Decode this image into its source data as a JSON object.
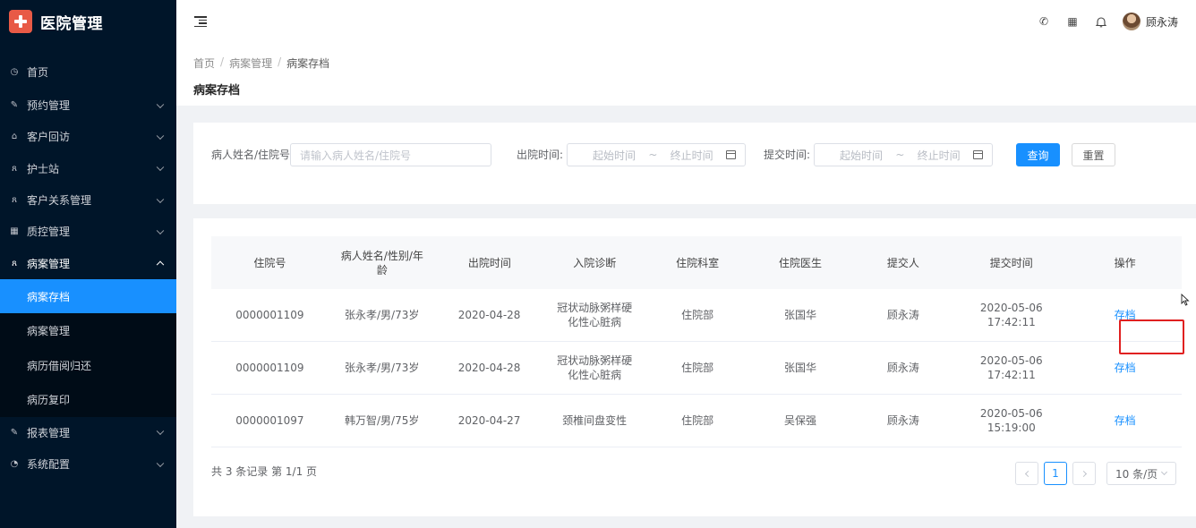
{
  "app": {
    "title": "医院管理"
  },
  "sidebar": {
    "items": [
      {
        "label": "首页",
        "icon": "dashboard-icon"
      },
      {
        "label": "预约管理",
        "icon": "edit-icon"
      },
      {
        "label": "客户回访",
        "icon": "home-icon"
      },
      {
        "label": "护士站",
        "icon": "nurse-icon"
      },
      {
        "label": "客户关系管理",
        "icon": "users-icon"
      },
      {
        "label": "质控管理",
        "icon": "table-icon"
      },
      {
        "label": "病案管理",
        "icon": "records-icon",
        "children": [
          "病案存档",
          "病案管理",
          "病历借阅归还",
          "病历复印"
        ],
        "active_child": "病案存档"
      },
      {
        "label": "报表管理",
        "icon": "report-icon"
      },
      {
        "label": "系统配置",
        "icon": "settings-icon"
      }
    ]
  },
  "header": {
    "username": "顾永涛",
    "icons": [
      "phone-icon",
      "grid-icon",
      "bell-icon"
    ]
  },
  "breadcrumb": [
    "首页",
    "病案管理",
    "病案存档"
  ],
  "page_title": "病案存档",
  "search": {
    "name_label": "病人姓名/住院号:",
    "name_placeholder": "请输入病人姓名/住院号",
    "discharge_label": "出院时间:",
    "submit_label": "提交时间:",
    "start_placeholder": "起始时间",
    "end_placeholder": "终止时间",
    "range_sep": "~",
    "query_button": "查询",
    "reset_button": "重置"
  },
  "table": {
    "headers": [
      "住院号",
      "病人姓名/性别/年龄",
      "出院时间",
      "入院诊断",
      "住院科室",
      "住院医生",
      "提交人",
      "提交时间",
      "操作"
    ],
    "rows": [
      {
        "id": "0000001109",
        "patient": "张永孝/男/73岁",
        "discharge": "2020-04-28",
        "diagnosis": "冠状动脉粥样硬化性心脏病",
        "dept": "住院部",
        "doctor": "张国华",
        "submitter": "顾永涛",
        "submit_date": "2020-05-06",
        "submit_time": "17:42:11",
        "action": "存档"
      },
      {
        "id": "0000001109",
        "patient": "张永孝/男/73岁",
        "discharge": "2020-04-28",
        "diagnosis": "冠状动脉粥样硬化性心脏病",
        "dept": "住院部",
        "doctor": "张国华",
        "submitter": "顾永涛",
        "submit_date": "2020-05-06",
        "submit_time": "17:42:11",
        "action": "存档"
      },
      {
        "id": "0000001097",
        "patient": "韩万智/男/75岁",
        "discharge": "2020-04-27",
        "diagnosis": "颈椎间盘变性",
        "dept": "住院部",
        "doctor": "吴保强",
        "submitter": "顾永涛",
        "submit_date": "2020-05-06",
        "submit_time": "15:19:00",
        "action": "存档"
      }
    ]
  },
  "pagination": {
    "total_text": "共 3 条记录 第 1/1 页",
    "current_page": "1",
    "page_size": "10 条/页"
  },
  "colors": {
    "sidebar_bg": "#001529",
    "accent": "#1890ff",
    "highlight": "#e02020",
    "logo": "#e85a46"
  }
}
